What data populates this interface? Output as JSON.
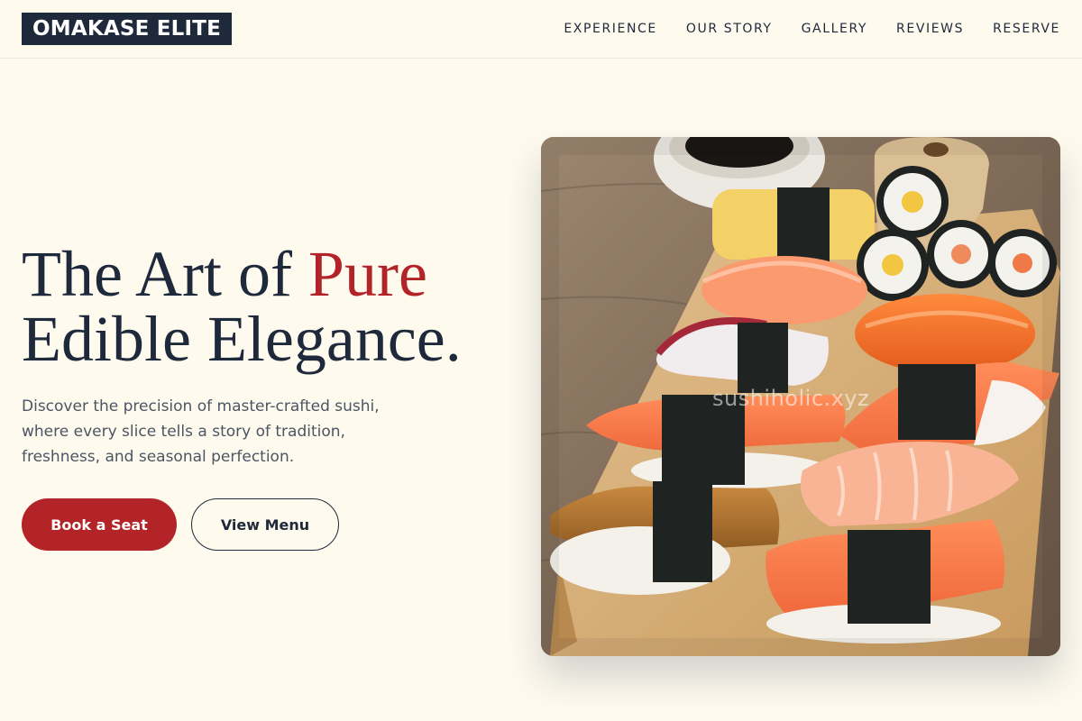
{
  "brand": {
    "logo_text": "OMAKASE ELITE"
  },
  "nav": {
    "items": [
      "EXPERIENCE",
      "OUR STORY",
      "GALLERY",
      "REVIEWS",
      "RESERVE"
    ]
  },
  "hero": {
    "title_line1_start": "The Art of ",
    "title_line1_accent": "Pure",
    "title_line2": "Edible Elegance.",
    "subtitle": "Discover the precision of master-crafted sushi, where every slice tells a story of tradition, freshness, and seasonal perfection.",
    "primary_button": "Book a Seat",
    "secondary_button": "View Menu"
  },
  "image": {
    "subject": "sushi platter on wooden board",
    "watermark": "sushiholic.xyz"
  },
  "colors": {
    "background": "#fefaee",
    "primary_dark": "#1e293b",
    "accent_red": "#b32428",
    "muted_text": "#4b5563"
  }
}
